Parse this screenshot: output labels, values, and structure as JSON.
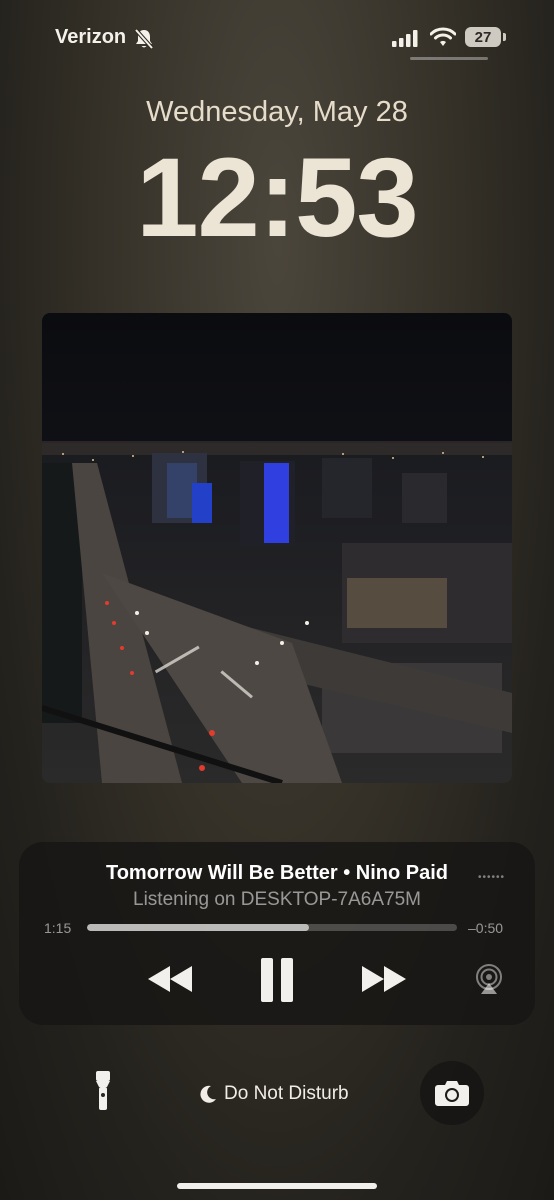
{
  "status_bar": {
    "carrier": "Verizon",
    "battery_level": "27",
    "silent_icon": "bell-slash-icon",
    "signal_icon": "cellular-signal-icon",
    "wifi_icon": "wifi-icon"
  },
  "lock_screen": {
    "date": "Wednesday, May 28",
    "time": "12:53"
  },
  "now_playing": {
    "title": "Tomorrow Will Be Better • Nino Paid",
    "device": "Listening on DESKTOP-7A6A75M",
    "elapsed": "1:15",
    "remaining": "–0:50",
    "progress_fraction": 0.6,
    "controls": [
      "rewind-icon",
      "pause-icon",
      "fast-forward-icon",
      "airplay-icon"
    ],
    "artwork_icon": "city-night-album-art"
  },
  "bottom_bar": {
    "flashlight_icon": "flashlight-icon",
    "focus_label": "Do Not Disturb",
    "focus_icon": "moon-icon",
    "camera_icon": "camera-icon"
  },
  "colors": {
    "time": "#ece4d4",
    "background": "#353128",
    "player_bg": "#161514"
  }
}
